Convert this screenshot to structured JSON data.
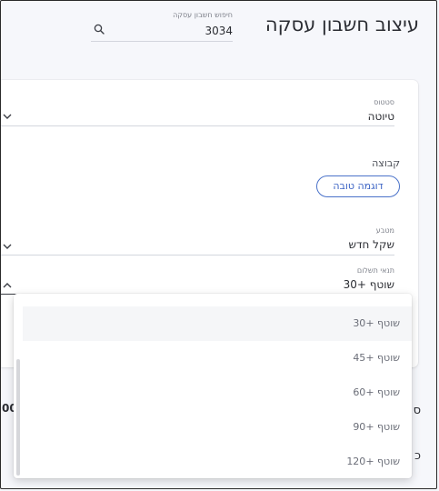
{
  "header": {
    "title": "עיצוב חשבון עסקה",
    "search": {
      "label": "חיפוש חשבון עסקה",
      "value": "3034"
    }
  },
  "form": {
    "status": {
      "label": "סטטוס",
      "value": "טיוטה"
    },
    "group": {
      "label": "קבוצה",
      "button_label": "דוגמה טובה"
    },
    "currency": {
      "label": "מטבע",
      "value": "שקל חדש"
    },
    "payment_terms": {
      "label": "תנאי תשלום",
      "value": "שוטף +30"
    }
  },
  "side_fragments": {
    "left_value": "00",
    "right_top": "ס",
    "right_bottom": "כ"
  },
  "payment_terms_dropdown": {
    "options": [
      {
        "label": "שוטף +30",
        "highlighted": true
      },
      {
        "label": "שוטף +45",
        "highlighted": false
      },
      {
        "label": "שוטף +60",
        "highlighted": false
      },
      {
        "label": "שוטף +90",
        "highlighted": false
      },
      {
        "label": "שוטף +120",
        "highlighted": false
      }
    ]
  },
  "icons": {
    "search": "search-icon",
    "chevron": "chevron-down-icon"
  },
  "colors": {
    "background": "#f6f7fb",
    "card": "#ffffff",
    "accent": "#3b63c4",
    "text": "#2b2d33",
    "muted": "#7d808a"
  }
}
